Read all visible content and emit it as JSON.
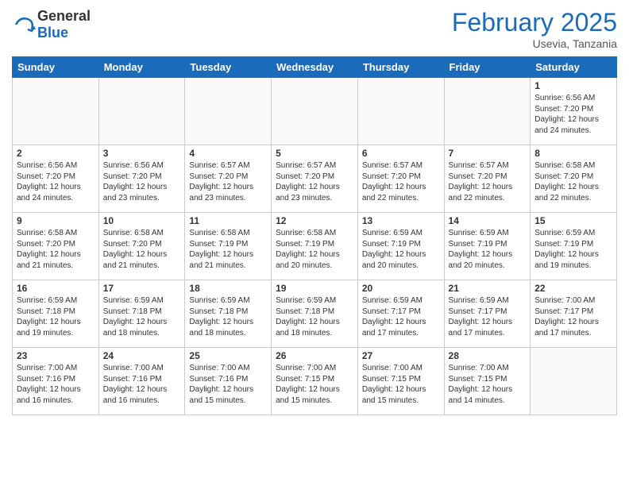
{
  "header": {
    "logo_general": "General",
    "logo_blue": "Blue",
    "month_title": "February 2025",
    "location": "Usevia, Tanzania"
  },
  "days_of_week": [
    "Sunday",
    "Monday",
    "Tuesday",
    "Wednesday",
    "Thursday",
    "Friday",
    "Saturday"
  ],
  "weeks": [
    {
      "days": [
        {
          "num": "",
          "info": ""
        },
        {
          "num": "",
          "info": ""
        },
        {
          "num": "",
          "info": ""
        },
        {
          "num": "",
          "info": ""
        },
        {
          "num": "",
          "info": ""
        },
        {
          "num": "",
          "info": ""
        },
        {
          "num": "1",
          "info": "Sunrise: 6:56 AM\nSunset: 7:20 PM\nDaylight: 12 hours\nand 24 minutes."
        }
      ]
    },
    {
      "days": [
        {
          "num": "2",
          "info": "Sunrise: 6:56 AM\nSunset: 7:20 PM\nDaylight: 12 hours\nand 24 minutes."
        },
        {
          "num": "3",
          "info": "Sunrise: 6:56 AM\nSunset: 7:20 PM\nDaylight: 12 hours\nand 23 minutes."
        },
        {
          "num": "4",
          "info": "Sunrise: 6:57 AM\nSunset: 7:20 PM\nDaylight: 12 hours\nand 23 minutes."
        },
        {
          "num": "5",
          "info": "Sunrise: 6:57 AM\nSunset: 7:20 PM\nDaylight: 12 hours\nand 23 minutes."
        },
        {
          "num": "6",
          "info": "Sunrise: 6:57 AM\nSunset: 7:20 PM\nDaylight: 12 hours\nand 22 minutes."
        },
        {
          "num": "7",
          "info": "Sunrise: 6:57 AM\nSunset: 7:20 PM\nDaylight: 12 hours\nand 22 minutes."
        },
        {
          "num": "8",
          "info": "Sunrise: 6:58 AM\nSunset: 7:20 PM\nDaylight: 12 hours\nand 22 minutes."
        }
      ]
    },
    {
      "days": [
        {
          "num": "9",
          "info": "Sunrise: 6:58 AM\nSunset: 7:20 PM\nDaylight: 12 hours\nand 21 minutes."
        },
        {
          "num": "10",
          "info": "Sunrise: 6:58 AM\nSunset: 7:20 PM\nDaylight: 12 hours\nand 21 minutes."
        },
        {
          "num": "11",
          "info": "Sunrise: 6:58 AM\nSunset: 7:19 PM\nDaylight: 12 hours\nand 21 minutes."
        },
        {
          "num": "12",
          "info": "Sunrise: 6:58 AM\nSunset: 7:19 PM\nDaylight: 12 hours\nand 20 minutes."
        },
        {
          "num": "13",
          "info": "Sunrise: 6:59 AM\nSunset: 7:19 PM\nDaylight: 12 hours\nand 20 minutes."
        },
        {
          "num": "14",
          "info": "Sunrise: 6:59 AM\nSunset: 7:19 PM\nDaylight: 12 hours\nand 20 minutes."
        },
        {
          "num": "15",
          "info": "Sunrise: 6:59 AM\nSunset: 7:19 PM\nDaylight: 12 hours\nand 19 minutes."
        }
      ]
    },
    {
      "days": [
        {
          "num": "16",
          "info": "Sunrise: 6:59 AM\nSunset: 7:18 PM\nDaylight: 12 hours\nand 19 minutes."
        },
        {
          "num": "17",
          "info": "Sunrise: 6:59 AM\nSunset: 7:18 PM\nDaylight: 12 hours\nand 18 minutes."
        },
        {
          "num": "18",
          "info": "Sunrise: 6:59 AM\nSunset: 7:18 PM\nDaylight: 12 hours\nand 18 minutes."
        },
        {
          "num": "19",
          "info": "Sunrise: 6:59 AM\nSunset: 7:18 PM\nDaylight: 12 hours\nand 18 minutes."
        },
        {
          "num": "20",
          "info": "Sunrise: 6:59 AM\nSunset: 7:17 PM\nDaylight: 12 hours\nand 17 minutes."
        },
        {
          "num": "21",
          "info": "Sunrise: 6:59 AM\nSunset: 7:17 PM\nDaylight: 12 hours\nand 17 minutes."
        },
        {
          "num": "22",
          "info": "Sunrise: 7:00 AM\nSunset: 7:17 PM\nDaylight: 12 hours\nand 17 minutes."
        }
      ]
    },
    {
      "days": [
        {
          "num": "23",
          "info": "Sunrise: 7:00 AM\nSunset: 7:16 PM\nDaylight: 12 hours\nand 16 minutes."
        },
        {
          "num": "24",
          "info": "Sunrise: 7:00 AM\nSunset: 7:16 PM\nDaylight: 12 hours\nand 16 minutes."
        },
        {
          "num": "25",
          "info": "Sunrise: 7:00 AM\nSunset: 7:16 PM\nDaylight: 12 hours\nand 15 minutes."
        },
        {
          "num": "26",
          "info": "Sunrise: 7:00 AM\nSunset: 7:15 PM\nDaylight: 12 hours\nand 15 minutes."
        },
        {
          "num": "27",
          "info": "Sunrise: 7:00 AM\nSunset: 7:15 PM\nDaylight: 12 hours\nand 15 minutes."
        },
        {
          "num": "28",
          "info": "Sunrise: 7:00 AM\nSunset: 7:15 PM\nDaylight: 12 hours\nand 14 minutes."
        },
        {
          "num": "",
          "info": ""
        }
      ]
    }
  ]
}
